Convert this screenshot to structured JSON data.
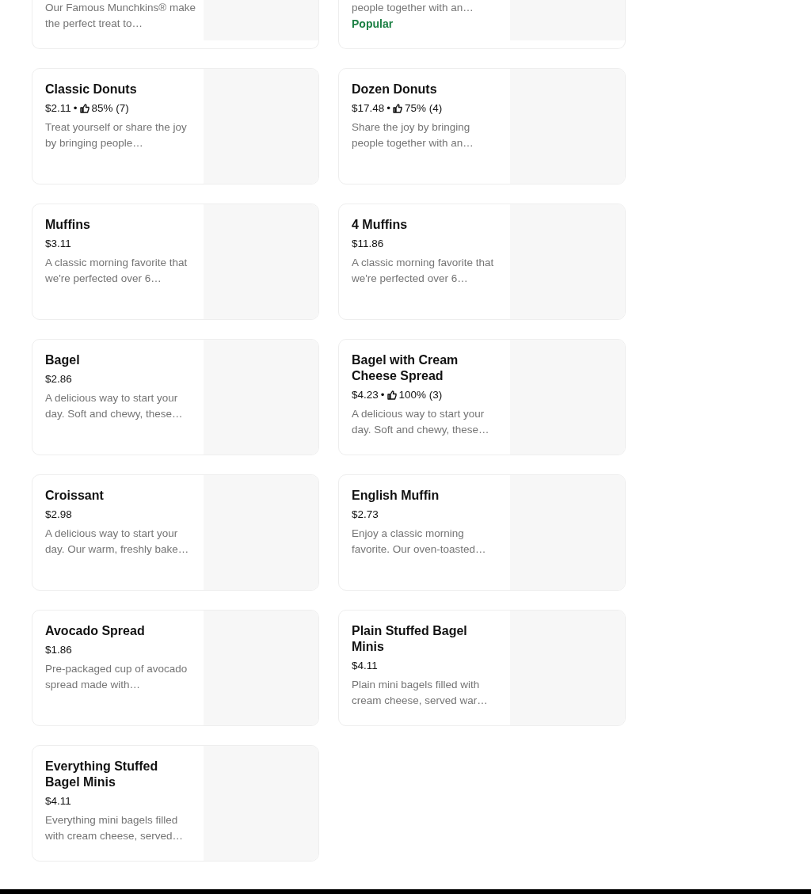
{
  "partial_items": [
    {
      "description": "Our Famous Munchkins® make the perfect treat to…"
    },
    {
      "description": "people together with an…",
      "tag": "Popular"
    }
  ],
  "items": [
    {
      "name": "Classic Donuts",
      "price": "$2.11",
      "separator": "•",
      "rating": "85% (7)",
      "description": "Treat yourself or share the joy by bringing people…"
    },
    {
      "name": "Dozen Donuts",
      "price": "$17.48",
      "separator": "•",
      "rating": "75% (4)",
      "description": "Share the joy by bringing people together with an…"
    },
    {
      "name": "Muffins",
      "price": "$3.11",
      "description": "A classic morning favorite that we're perfected over 6…"
    },
    {
      "name": "4 Muffins",
      "price": "$11.86",
      "description": "A classic morning favorite that we're perfected over 6…"
    },
    {
      "name": "Bagel",
      "price": "$2.86",
      "description": "A delicious way to start your day. Soft and chewy, these…"
    },
    {
      "name": "Bagel with Cream Cheese Spread",
      "price": "$4.23",
      "separator": "•",
      "rating": "100% (3)",
      "description": "A delicious way to start your day. Soft and chewy, these…"
    },
    {
      "name": "Croissant",
      "price": "$2.98",
      "description": "A delicious way to start your day. Our warm, freshly bake…"
    },
    {
      "name": "English Muffin",
      "price": "$2.73",
      "description": "Enjoy a classic morning favorite. Our oven-toasted…"
    },
    {
      "name": "Avocado Spread",
      "price": "$1.86",
      "description": "Pre-packaged cup of avocado spread made with…"
    },
    {
      "name": "Plain Stuffed Bagel Minis",
      "price": "$4.11",
      "description": "Plain mini bagels filled with cream cheese, served war…"
    },
    {
      "name": "Everything Stuffed Bagel Minis",
      "price": "$4.11",
      "description": "Everything mini bagels filled with cream cheese, served…"
    }
  ]
}
